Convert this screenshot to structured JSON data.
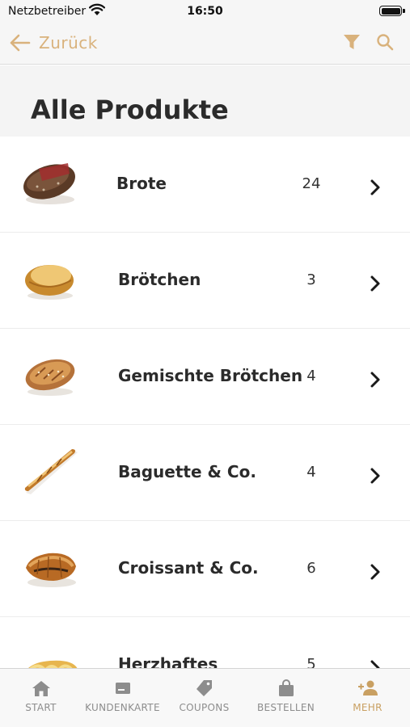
{
  "status_bar": {
    "carrier": "Netzbetreiber",
    "time": "16:50"
  },
  "nav": {
    "back_label": "Zurück",
    "accent_color": "#d9b27c"
  },
  "page": {
    "title": "Alle Produkte"
  },
  "products": [
    {
      "name": "Brote",
      "count": "24",
      "image_icon": "bread-loaf-icon"
    },
    {
      "name": "Brötchen",
      "count": "3",
      "image_icon": "bread-roll-icon"
    },
    {
      "name": "Gemischte Brötchen",
      "count": "4",
      "image_icon": "seeded-roll-icon"
    },
    {
      "name": "Baguette & Co.",
      "count": "4",
      "image_icon": "baguette-icon"
    },
    {
      "name": "Croissant & Co.",
      "count": "6",
      "image_icon": "croissant-icon"
    },
    {
      "name": "Herzhaftes",
      "count": "5",
      "image_icon": "savory-pastry-icon"
    }
  ],
  "tabs": [
    {
      "label": "START",
      "icon": "home-icon"
    },
    {
      "label": "KUNDENKARTE",
      "icon": "card-icon"
    },
    {
      "label": "COUPONS",
      "icon": "tag-icon"
    },
    {
      "label": "BESTELLEN",
      "icon": "bag-icon"
    },
    {
      "label": "MEHR",
      "icon": "add-user-icon",
      "active": true
    }
  ]
}
